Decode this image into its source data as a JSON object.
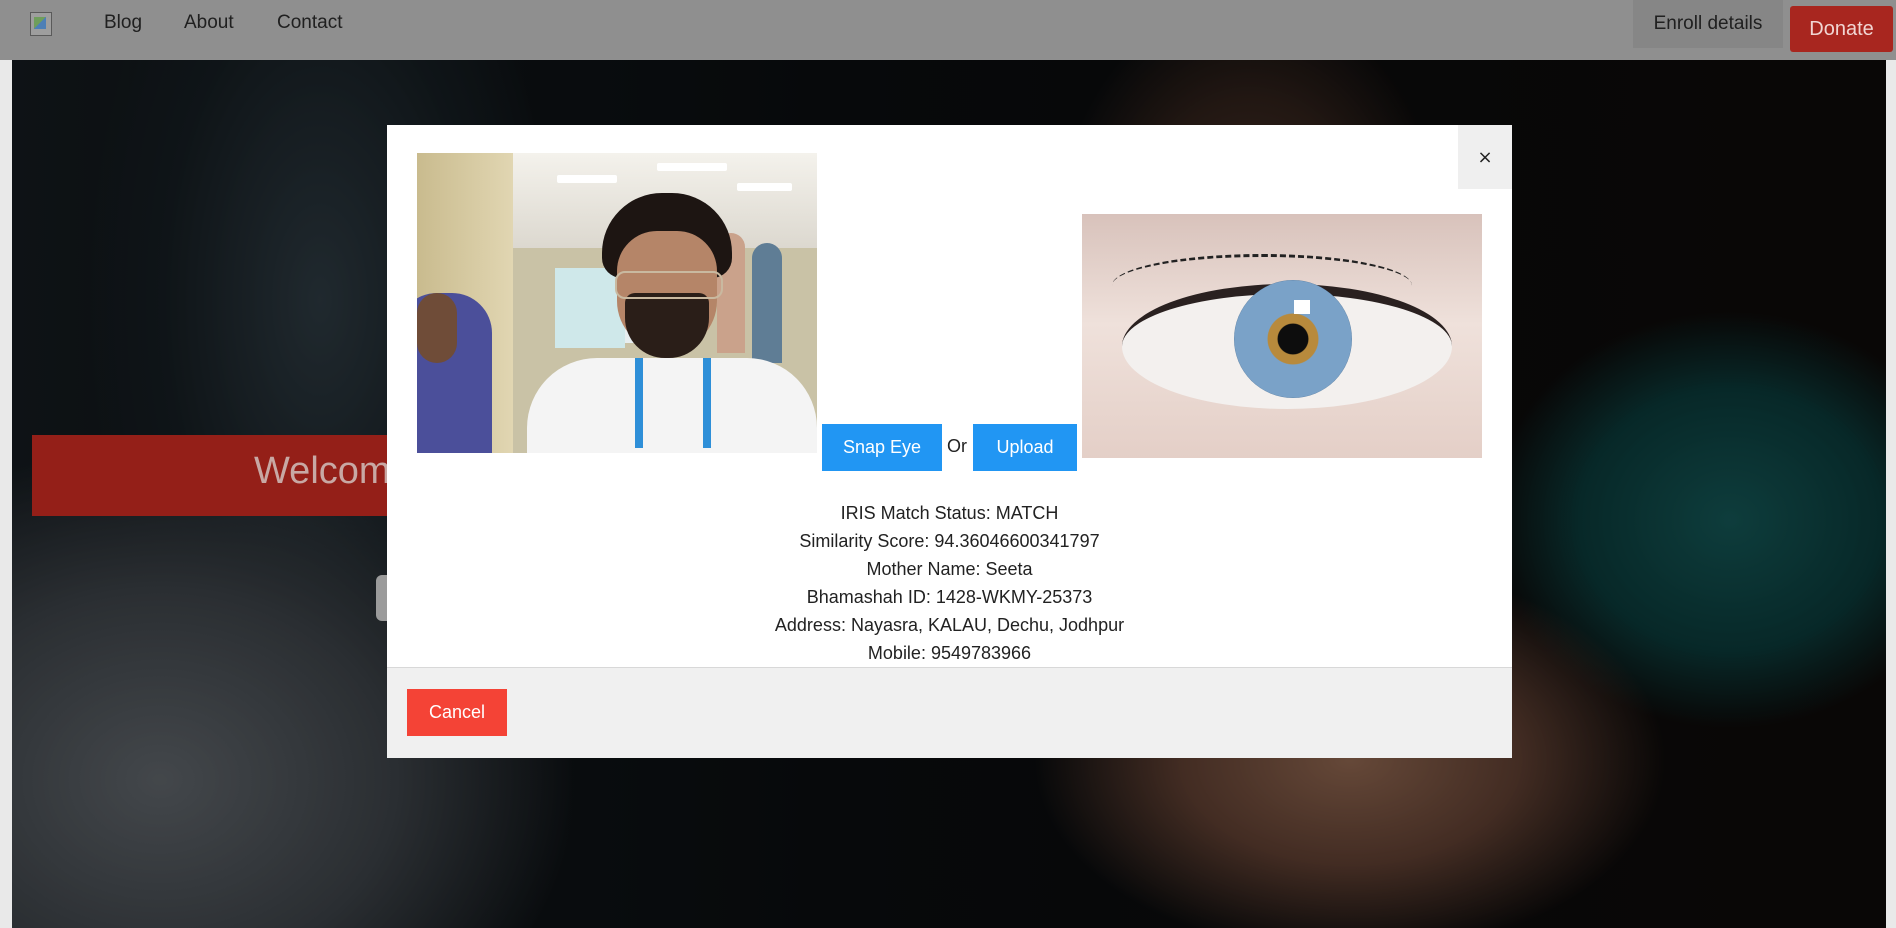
{
  "navbar": {
    "logo_alt": "logo",
    "links": [
      "Blog",
      "About",
      "Contact"
    ],
    "enroll_label": "Enroll details",
    "donate_label": "Donate"
  },
  "hero": {
    "welcome_text": "Welcom"
  },
  "modal": {
    "close_label": "×",
    "snap_eye_label": "Snap Eye",
    "or_label": "Or",
    "upload_label": "Upload",
    "results": {
      "status": "IRIS Match Status: MATCH",
      "similarity": "Similarity Score: 94.36046600341797",
      "mother": "Mother Name: Seeta",
      "bhamashah": "Bhamashah ID: 1428-WKMY-25373",
      "address": "Address: Nayasra, KALAU, Dechu, Jodhpur",
      "mobile": "Mobile: 9549783966"
    },
    "cancel_label": "Cancel"
  },
  "colors": {
    "primary_button": "#2196f3",
    "cancel_button": "#f44336",
    "donate_button": "#a8261f",
    "welcome_banner": "#941f18"
  }
}
